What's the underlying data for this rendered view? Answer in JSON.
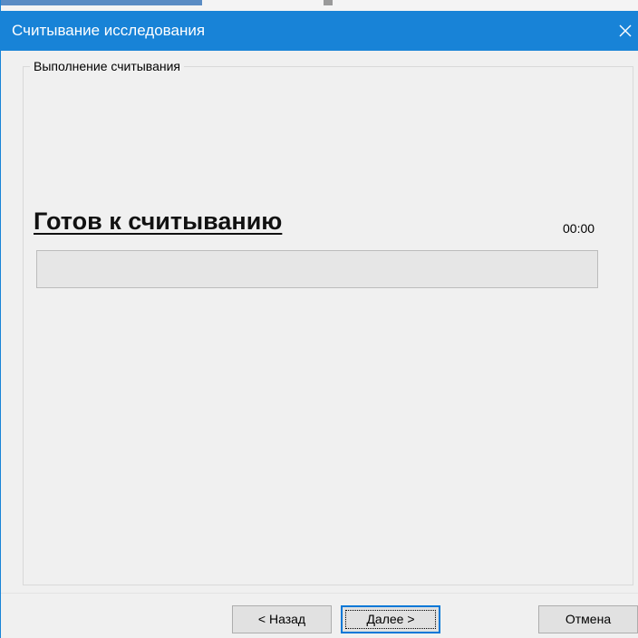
{
  "window": {
    "title": "Считывание исследования",
    "close_icon": "close-icon"
  },
  "group": {
    "legend": "Выполнение считывания"
  },
  "status": {
    "text": "Готов к считыванию",
    "timer": "00:00",
    "progress_fraction": 0.0
  },
  "buttons": {
    "back_label": "< Назад",
    "next_label": "Далее >",
    "cancel_label": "Отмена"
  },
  "colors": {
    "titlebar": "#1883d7",
    "background": "#f0f0f0",
    "progress_track": "#e6e6e6",
    "progress_fill": "#06b025",
    "focus_border": "#0078d7"
  }
}
